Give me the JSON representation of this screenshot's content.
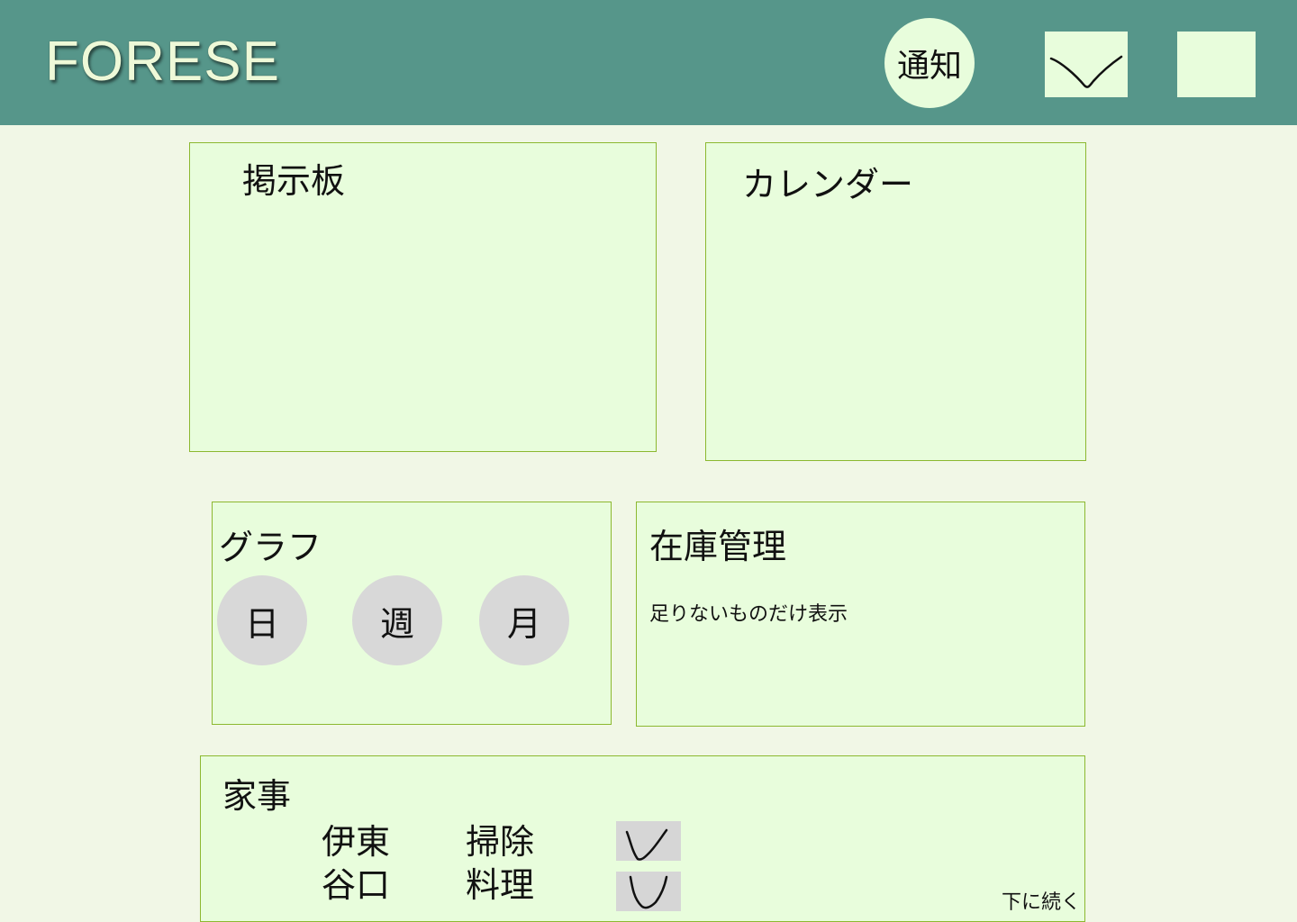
{
  "header": {
    "app_title": "FORESE",
    "notify_label": "通知"
  },
  "bulletin": {
    "title": "掲示板"
  },
  "calendar": {
    "title": "カレンダー"
  },
  "graph": {
    "title": "グラフ",
    "periods": [
      "日",
      "週",
      "月"
    ]
  },
  "inventory": {
    "title": "在庫管理",
    "note": "足りないものだけ表示"
  },
  "chores": {
    "title": "家事",
    "rows": [
      {
        "person": "伊東",
        "task": "掃除"
      },
      {
        "person": "谷口",
        "task": "料理"
      }
    ],
    "more_label": "下に続く"
  }
}
